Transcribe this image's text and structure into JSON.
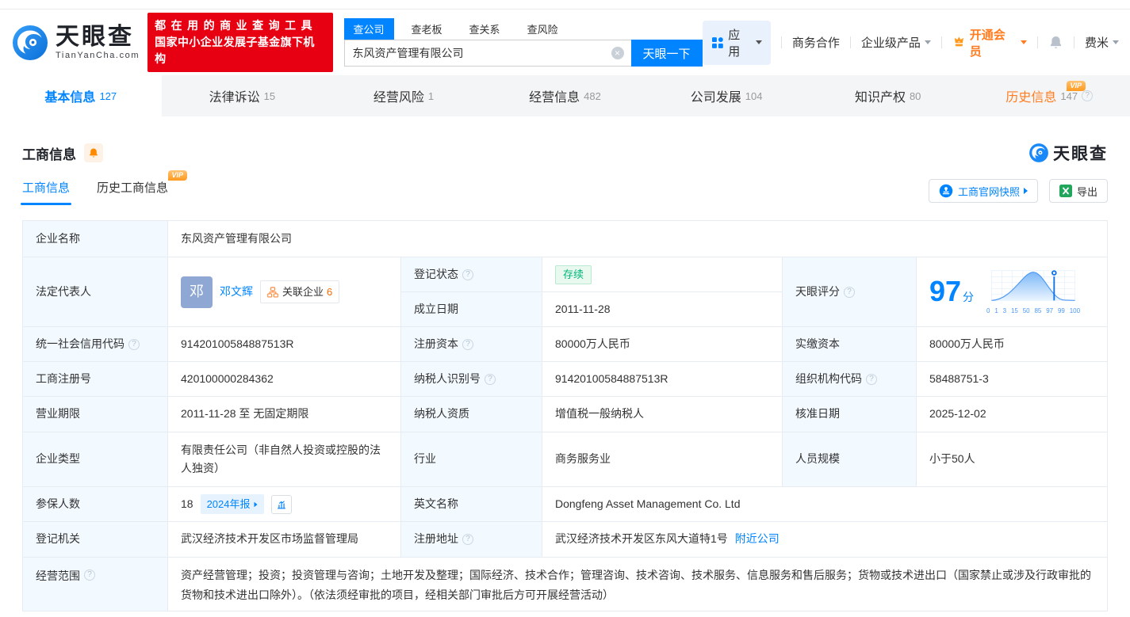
{
  "header": {
    "logo": {
      "name": "天眼查",
      "domain": "TianYanCha.com"
    },
    "slogan_line1": "都在用的商业查询工具",
    "slogan_line2": "国家中小企业发展子基金旗下机构",
    "search": {
      "tabs": [
        "查公司",
        "查老板",
        "查关系",
        "查风险"
      ],
      "active_tab": "查公司",
      "value": "东风资产管理有限公司",
      "button": "天眼一下"
    },
    "nav": {
      "apps": "应用",
      "cooperation": "商务合作",
      "enterprise": "企业级产品",
      "vip": "开通会员",
      "username": "费米"
    }
  },
  "page_tabs": [
    {
      "label": "基本信息",
      "count": "127"
    },
    {
      "label": "法律诉讼",
      "count": "15"
    },
    {
      "label": "经营风险",
      "count": "1"
    },
    {
      "label": "经营信息",
      "count": "482"
    },
    {
      "label": "公司发展",
      "count": "104"
    },
    {
      "label": "知识产权",
      "count": "80"
    },
    {
      "label": "历史信息",
      "count": "147",
      "vip": "VIP"
    }
  ],
  "section": {
    "title": "工商信息",
    "subtab_current": "工商信息",
    "subtab_history": "历史工商信息",
    "vip": "VIP",
    "watermark": "天眼查",
    "snapshot_button": "工商官网快照",
    "export_button": "导出"
  },
  "table": {
    "company_name": {
      "label": "企业名称",
      "value": "东风资产管理有限公司"
    },
    "legal_rep": {
      "label": "法定代表人",
      "avatar": "邓",
      "name": "邓文辉",
      "related": "关联企业",
      "related_count": "6"
    },
    "reg_status": {
      "label": "登记状态",
      "value": "存续"
    },
    "establish_date": {
      "label": "成立日期",
      "value": "2011-11-28"
    },
    "score": {
      "label": "天眼评分",
      "value": "97",
      "unit": "分",
      "axis": [
        "0",
        "1",
        "3",
        "15",
        "50",
        "85",
        "97",
        "99",
        "100"
      ]
    },
    "credit_code": {
      "label": "统一社会信用代码",
      "value": "91420100584887513R"
    },
    "reg_capital": {
      "label": "注册资本",
      "value": "80000万人民币"
    },
    "paid_capital": {
      "label": "实缴资本",
      "value": "80000万人民币"
    },
    "reg_number": {
      "label": "工商注册号",
      "value": "420100000284362"
    },
    "taxpayer_id": {
      "label": "纳税人识别号",
      "value": "91420100584887513R"
    },
    "org_code": {
      "label": "组织机构代码",
      "value": "58488751-3"
    },
    "business_term": {
      "label": "营业期限",
      "value": "2011-11-28 至 无固定期限"
    },
    "taxpayer_quality": {
      "label": "纳税人资质",
      "value": "增值税一般纳税人"
    },
    "approval_date": {
      "label": "核准日期",
      "value": "2025-12-02"
    },
    "company_type": {
      "label": "企业类型",
      "value": "有限责任公司（非自然人投资或控股的法人独资）"
    },
    "industry": {
      "label": "行业",
      "value": "商务服务业"
    },
    "staff_size": {
      "label": "人员规模",
      "value": "小于50人"
    },
    "insured_count": {
      "label": "参保人数",
      "value": "18",
      "report_badge": "2024年报"
    },
    "english_name": {
      "label": "英文名称",
      "value": "Dongfeng Asset Management Co. Ltd"
    },
    "reg_authority": {
      "label": "登记机关",
      "value": "武汉经济技术开发区市场监督管理局"
    },
    "reg_address": {
      "label": "注册地址",
      "value": "武汉经济技术开发区东风大道特1号",
      "nearby_link": "附近公司"
    },
    "business_scope": {
      "label": "经营范围",
      "value": "资产经营管理；投资；投资管理与咨询；土地开发及整理；国际经济、技术合作；管理咨询、技术咨询、技术服务、信息服务和售后服务；货物或技术进出口（国家禁止或涉及行政审批的货物和技术进出口除外）。（依法须经审批的项目，经相关部门审批后方可开展经营活动）"
    }
  },
  "colors": {
    "brand_blue": "#0084ff",
    "banner_red": "#e60012",
    "vip_orange": "#ff9a1f",
    "status_green": "#00b578"
  }
}
